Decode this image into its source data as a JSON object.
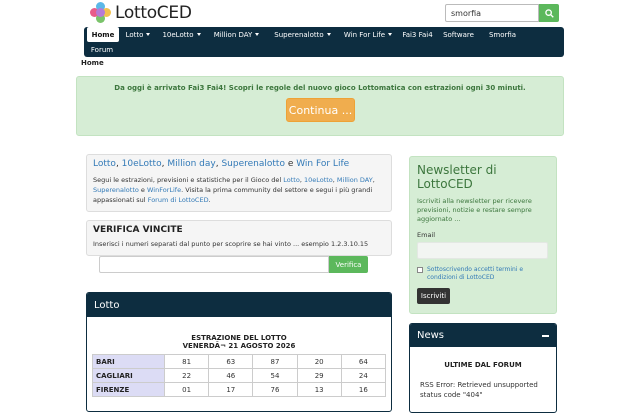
{
  "brand": {
    "name": "LottoCED",
    "colors": {
      "navbar": "#0d2d40",
      "success": "#5cb85c",
      "warning": "#f0ad4e",
      "alert_bg": "#d6edd5",
      "link": "#337ab7"
    }
  },
  "search": {
    "value": "smorfia",
    "icon": "search-icon"
  },
  "nav": {
    "items": [
      {
        "label": "Home",
        "active": true
      },
      {
        "label": "Lotto",
        "dropdown": true
      },
      {
        "label": "10eLotto",
        "dropdown": true
      },
      {
        "label": "Million DAY",
        "dropdown": true
      },
      {
        "label": "Superenalotto",
        "dropdown": true
      },
      {
        "label": "Win For Life",
        "dropdown": true
      },
      {
        "label": "Fai3 Fai4"
      },
      {
        "label": "Software"
      },
      {
        "label": "Smorfia"
      },
      {
        "label": "Forum"
      }
    ]
  },
  "breadcrumb": "Home",
  "alert": {
    "text": "Da oggi è arrivato Fai3 Fai4! Scopri le regole del nuovo gioco Lottomatica con estrazioni ogni 30 minuti.",
    "button": "Continua ..."
  },
  "intro": {
    "title_links": [
      "Lotto",
      "10eLotto",
      "Million day",
      "Superenalotto",
      "Win For Life"
    ],
    "title_seps": [
      ", ",
      ", ",
      ", ",
      " e "
    ],
    "body": {
      "t1": "Segui le estrazioni, previsioni e statistiche per il Gioco del ",
      "l1": "Lotto",
      "s1": ", ",
      "l2": "10eLotto",
      "s2": ", ",
      "l3": "Million DAY",
      "s3": ", ",
      "l4": "Superenalotto",
      "s4": " e ",
      "l5": "WinForLife",
      "t2": ". Visita la prima community del settore e segui i più grandi appassionati sul ",
      "l6": "Forum di LottoCED",
      "t3": "."
    }
  },
  "verifica": {
    "title": "VERIFICA VINCITE",
    "hint": "Inserisci i numeri separati dal punto per scoprire se hai vinto ... esempio 1.2.3.10.15",
    "button": "Verifica"
  },
  "lotto": {
    "heading": "Lotto",
    "title_line1": "ESTRAZIONE DEL LOTTO",
    "title_line2": "VENERDÃ¬ 21 AGOSTO 2026",
    "rows": [
      {
        "wheel": "BARI",
        "numbers": [
          "81",
          "63",
          "87",
          "20",
          "64"
        ]
      },
      {
        "wheel": "CAGLIARI",
        "numbers": [
          "22",
          "46",
          "54",
          "29",
          "24"
        ]
      },
      {
        "wheel": "FIRENZE",
        "numbers": [
          "01",
          "17",
          "76",
          "13",
          "16"
        ]
      }
    ]
  },
  "newsletter": {
    "title": "Newsletter di LottoCED",
    "text": "Iscriviti alla newsletter per ricevere previsioni, notizie e restare sempre aggiornato ...",
    "email_label": "Email",
    "consent": "Sottoscrivendo accetti termini e condizioni di LottoCED",
    "button": "Iscriviti"
  },
  "news": {
    "heading": "News",
    "subheading": "ULTIME DAL FORUM",
    "error": "RSS Error: Retrieved unsupported status code \"404\""
  }
}
